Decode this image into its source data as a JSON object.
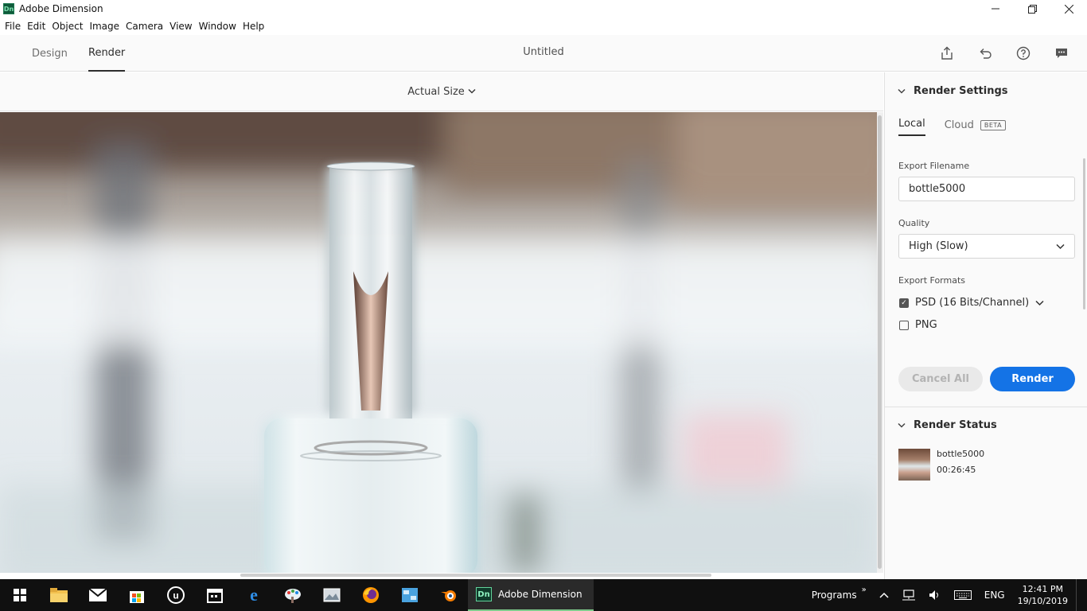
{
  "window": {
    "app_icon": "Dn",
    "title": "Adobe Dimension",
    "controls": [
      "minimize-icon",
      "restore-icon",
      "close-icon"
    ]
  },
  "menu": [
    "File",
    "Edit",
    "Object",
    "Image",
    "Camera",
    "View",
    "Window",
    "Help"
  ],
  "modes": {
    "design": "Design",
    "render": "Render",
    "active": "Render"
  },
  "document_title": "Untitled",
  "toolbar_icons": [
    "share-icon",
    "undo-icon",
    "help-icon",
    "feedback-icon"
  ],
  "viewport": {
    "zoom": "Actual Size"
  },
  "render_settings": {
    "title": "Render Settings",
    "tabs": {
      "local": "Local",
      "cloud": "Cloud",
      "beta": "BETA"
    },
    "export_filename_label": "Export Filename",
    "export_filename": "bottle5000",
    "quality_label": "Quality",
    "quality": "High (Slow)",
    "formats_label": "Export Formats",
    "formats": [
      {
        "label": "PSD (16 Bits/Channel)",
        "checked": true
      },
      {
        "label": "PNG",
        "checked": false
      }
    ],
    "cancel_label": "Cancel All",
    "render_label": "Render"
  },
  "render_status": {
    "title": "Render Status",
    "item_name": "bottle5000",
    "item_time": "00:26:45"
  },
  "taskbar": {
    "active_app": "Adobe Dimension",
    "active_icon": "Dn",
    "programs": "Programs",
    "lang": "ENG",
    "time": "12:41 PM",
    "date": "19/10/2019"
  },
  "colors": {
    "accent": "#1473e6",
    "taskbar": "#101010"
  }
}
